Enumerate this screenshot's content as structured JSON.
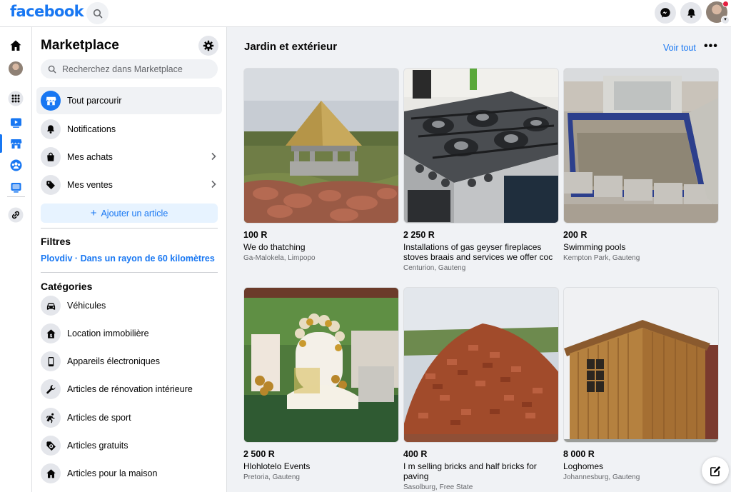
{
  "brand": {
    "logo_text": "facebook",
    "accent": "#1877f2"
  },
  "topbar": {
    "icons": [
      "search-icon",
      "messenger-icon",
      "bell-icon",
      "avatar"
    ]
  },
  "rail": {
    "icons": [
      "home-icon",
      "avatar",
      "apps-grid-icon",
      "watch-icon",
      "marketplace-icon",
      "groups-icon",
      "gaming-icon",
      "link-icon"
    ]
  },
  "sidebar": {
    "title": "Marketplace",
    "search_placeholder": "Recherchez dans Marketplace",
    "nav": [
      {
        "label": "Tout parcourir",
        "icon": "store-icon",
        "active": true
      },
      {
        "label": "Notifications",
        "icon": "bell-icon"
      },
      {
        "label": "Mes achats",
        "icon": "bag-icon",
        "has_chevron": true
      },
      {
        "label": "Mes ventes",
        "icon": "tag-icon",
        "has_chevron": true
      }
    ],
    "add_button": "Ajouter un article",
    "filters_title": "Filtres",
    "location_filter": "Plovdiv · Dans un rayon de 60 kilomètres",
    "categories_title": "Catégories",
    "categories": [
      {
        "label": "Véhicules",
        "icon": "car-icon"
      },
      {
        "label": "Location immobilière",
        "icon": "house-dollar-icon"
      },
      {
        "label": "Appareils électroniques",
        "icon": "phone-icon"
      },
      {
        "label": "Articles de rénovation intérieure",
        "icon": "wrench-icon"
      },
      {
        "label": "Articles de sport",
        "icon": "runner-icon"
      },
      {
        "label": "Articles gratuits",
        "icon": "free-tag-icon"
      },
      {
        "label": "Articles pour la maison",
        "icon": "home-icon"
      }
    ]
  },
  "main": {
    "section_title": "Jardin et extérieur",
    "see_all": "Voir tout",
    "more": "•••",
    "listings": [
      {
        "price": "100 R",
        "title": "We do thatching",
        "location": "Ga-Malokela, Limpopo",
        "photo": "thatched-gazebo"
      },
      {
        "price": "2 250 R",
        "title": "Installations of gas geyser fireplaces stoves braais and services we offer coc",
        "location": "Centurion, Gauteng",
        "photo": "gas-stove"
      },
      {
        "price": "200 R",
        "title": "Swimming pools",
        "location": "Kempton Park, Gauteng",
        "photo": "pool-construction"
      },
      {
        "price": "2 500 R",
        "title": "Hlohlotelo Events",
        "location": "Pretoria, Gauteng",
        "photo": "event-decor"
      },
      {
        "price": "400 R",
        "title": "I m selling bricks and half bricks for paving",
        "location": "Sasolburg, Free State",
        "photo": "brick-pile"
      },
      {
        "price": "8 000 R",
        "title": "Loghomes",
        "location": "Johannesburg, Gauteng",
        "photo": "wooden-cabin"
      }
    ]
  }
}
